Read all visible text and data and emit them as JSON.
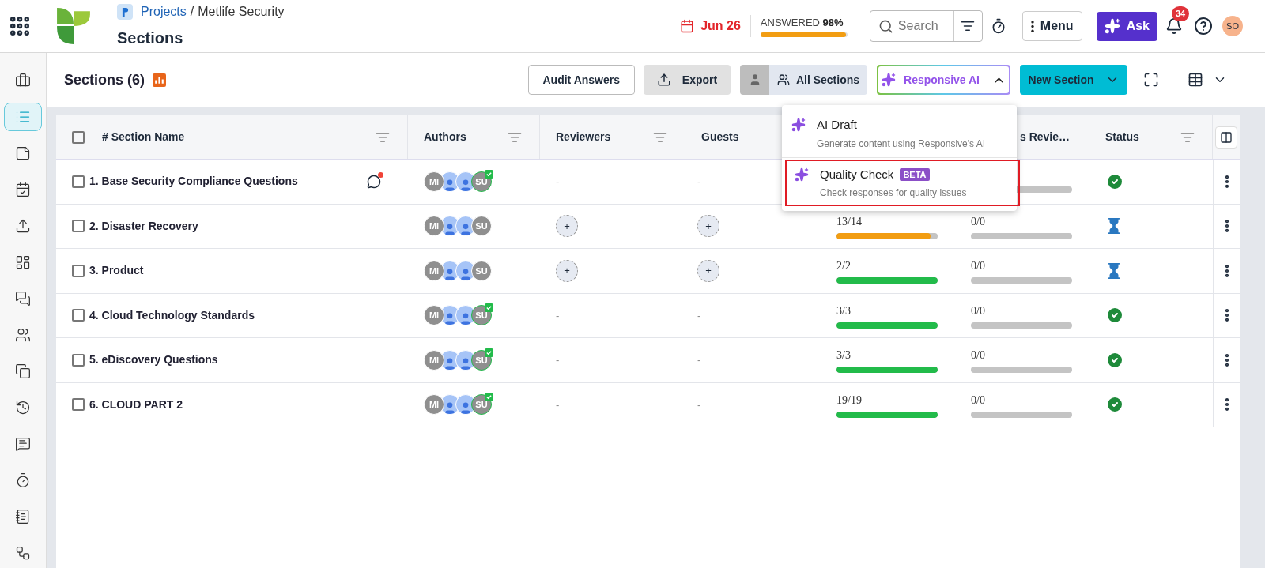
{
  "header": {
    "breadcrumb": {
      "parent": "Projects",
      "separator": "/",
      "current": "Metlife Security"
    },
    "title": "Sections",
    "due_date": "Jun 26",
    "progress": {
      "label": "ANSWERED",
      "value": "98%",
      "level": 0.98
    },
    "search": {
      "placeholder": "Search"
    },
    "menu_button": "Menu",
    "ask_button": "Ask",
    "notifications": "34",
    "avatar": "SO"
  },
  "sidebar": {
    "items": [
      {
        "kind": "briefcase",
        "selected": false
      },
      {
        "kind": "list",
        "selected": true
      },
      {
        "kind": "note",
        "selected": false
      },
      {
        "kind": "calendar",
        "selected": false
      },
      {
        "kind": "upload",
        "selected": false
      },
      {
        "kind": "layout",
        "selected": false
      },
      {
        "kind": "messages",
        "selected": false
      },
      {
        "kind": "users",
        "selected": false
      },
      {
        "kind": "copy",
        "selected": false
      },
      {
        "kind": "history",
        "selected": false
      },
      {
        "kind": "question",
        "selected": false
      },
      {
        "kind": "timer",
        "selected": false
      },
      {
        "kind": "notebook",
        "selected": false
      },
      {
        "kind": "workflow",
        "selected": false
      }
    ]
  },
  "toolbar": {
    "title": "Sections (6)",
    "audit_button": "Audit Answers",
    "export_button": "Export",
    "filter_button": "All Sections",
    "ai_button": {
      "label": "Responsive AI",
      "expanded": true
    },
    "new_button": "New Section"
  },
  "ai_menu": [
    {
      "title": "AI Draft",
      "description": "Generate content using Responsive's AI",
      "highlighted": false
    },
    {
      "title": "Quality Check",
      "badge": "BETA",
      "description": "Check responses for quality issues",
      "highlighted": true
    }
  ],
  "table": {
    "select_all": {
      "checked": false
    },
    "columns": [
      {
        "label": "# Section Name",
        "filter": true
      },
      {
        "label": "Authors",
        "filter": true
      },
      {
        "label": "Reviewers",
        "filter": true
      },
      {
        "label": "Guests"
      },
      {},
      {
        "label": "s Revie…"
      },
      {
        "label": "Status",
        "filter": true
      }
    ],
    "rows": [
      {
        "checked": false,
        "name": "1. Base Security Compliance Questions",
        "comment": true,
        "authors": [
          {
            "kind": "initials",
            "text": "MI",
            "done": false
          },
          {
            "kind": "person"
          },
          {
            "kind": "person"
          },
          {
            "kind": "initials",
            "text": "SU",
            "done": true
          }
        ],
        "reviewers": {
          "kind": "empty",
          "text": "-"
        },
        "guests": {
          "kind": "empty",
          "text": "-"
        },
        "answered": null,
        "reviewed": {
          "level": 0,
          "color": "#bdbdbd"
        },
        "status": {
          "kind": "done"
        }
      },
      {
        "checked": false,
        "name": "2. Disaster Recovery",
        "comment": false,
        "authors": [
          {
            "kind": "initials",
            "text": "MI",
            "done": false
          },
          {
            "kind": "person"
          },
          {
            "kind": "person"
          },
          {
            "kind": "initials",
            "text": "SU",
            "done": false
          }
        ],
        "reviewers": {
          "kind": "add",
          "text": "+"
        },
        "guests": {
          "kind": "add",
          "text": "+"
        },
        "answered": {
          "text": "13/14",
          "level": 0.93,
          "color": "#f29d12"
        },
        "reviewed": {
          "text": "0/0",
          "level": 0,
          "color": "#bdbdbd"
        },
        "status": {
          "kind": "pending"
        }
      },
      {
        "checked": false,
        "name": "3. Product",
        "comment": false,
        "authors": [
          {
            "kind": "initials",
            "text": "MI",
            "done": false
          },
          {
            "kind": "person"
          },
          {
            "kind": "person"
          },
          {
            "kind": "initials",
            "text": "SU",
            "done": false
          }
        ],
        "reviewers": {
          "kind": "add",
          "text": "+"
        },
        "guests": {
          "kind": "add",
          "text": "+"
        },
        "answered": {
          "text": "2/2",
          "level": 1,
          "color": "#22bb4a"
        },
        "reviewed": {
          "text": "0/0",
          "level": 0,
          "color": "#bdbdbd"
        },
        "status": {
          "kind": "pending"
        }
      },
      {
        "checked": false,
        "name": "4. Cloud Technology Standards",
        "comment": false,
        "authors": [
          {
            "kind": "initials",
            "text": "MI",
            "done": false
          },
          {
            "kind": "person"
          },
          {
            "kind": "person"
          },
          {
            "kind": "initials",
            "text": "SU",
            "done": true
          }
        ],
        "reviewers": {
          "kind": "empty",
          "text": "-"
        },
        "guests": {
          "kind": "empty",
          "text": "-"
        },
        "answered": {
          "text": "3/3",
          "level": 1,
          "color": "#22bb4a"
        },
        "reviewed": {
          "text": "0/0",
          "level": 0,
          "color": "#bdbdbd"
        },
        "status": {
          "kind": "done"
        }
      },
      {
        "checked": false,
        "name": "5. eDiscovery Questions",
        "comment": false,
        "authors": [
          {
            "kind": "initials",
            "text": "MI",
            "done": false
          },
          {
            "kind": "person"
          },
          {
            "kind": "person"
          },
          {
            "kind": "initials",
            "text": "SU",
            "done": true
          }
        ],
        "reviewers": {
          "kind": "empty",
          "text": "-"
        },
        "guests": {
          "kind": "empty",
          "text": "-"
        },
        "answered": {
          "text": "3/3",
          "level": 1,
          "color": "#22bb4a"
        },
        "reviewed": {
          "text": "0/0",
          "level": 0,
          "color": "#bdbdbd"
        },
        "status": {
          "kind": "done"
        }
      },
      {
        "checked": false,
        "name": "6. CLOUD PART 2",
        "comment": false,
        "authors": [
          {
            "kind": "initials",
            "text": "MI",
            "done": false
          },
          {
            "kind": "person"
          },
          {
            "kind": "person"
          },
          {
            "kind": "initials",
            "text": "SU",
            "done": true
          }
        ],
        "reviewers": {
          "kind": "empty",
          "text": "-"
        },
        "guests": {
          "kind": "empty",
          "text": "-"
        },
        "answered": {
          "text": "19/19",
          "level": 1,
          "color": "#22bb4a"
        },
        "reviewed": {
          "text": "0/0",
          "level": 0,
          "color": "#bdbdbd"
        },
        "status": {
          "kind": "done"
        }
      }
    ]
  }
}
